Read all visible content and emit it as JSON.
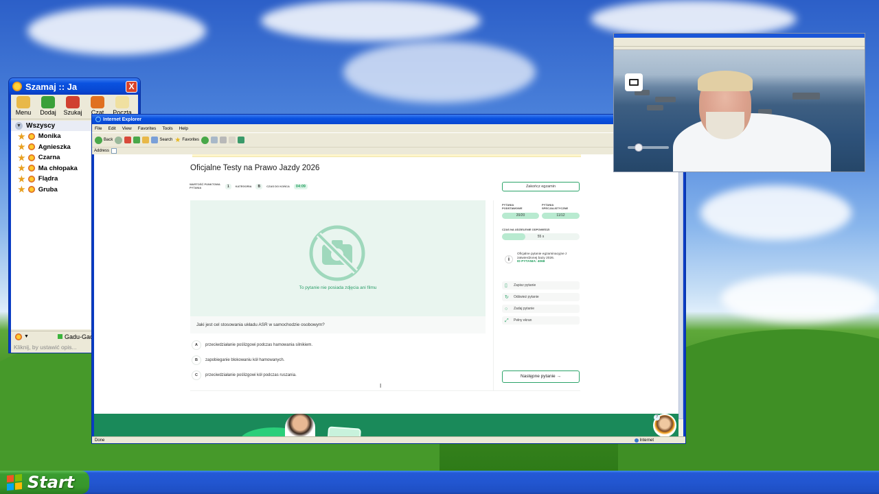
{
  "taskbar": {
    "start_label": "Start"
  },
  "gg_window": {
    "title": "Szamaj :: Ja",
    "close_label": "X",
    "toolbar": [
      "Menu",
      "Dodaj",
      "Szukaj",
      "Czat",
      "Poczta"
    ],
    "group": "Wszyscy",
    "contacts": [
      "Monika",
      "Agnieszka",
      "Czarna",
      "Ma chłopaka",
      "Flądra",
      "Gruba"
    ],
    "status_network": "Gadu-Gadu",
    "description_placeholder": "Kliknij, by ustawić opis..."
  },
  "ie_window": {
    "title": "Internet Explorer",
    "menu": [
      "File",
      "Edit",
      "View",
      "Favorites",
      "Tools",
      "Help"
    ],
    "toolbar": {
      "back": "Back",
      "search": "Search",
      "favorites": "Favorites"
    },
    "address_label": "Address",
    "status_left": "Done",
    "status_zone": "Internet"
  },
  "exam": {
    "title": "Oficjalne Testy na Prawo Jazdy 2026",
    "meta": {
      "points_label": "WARTOŚĆ PUNKTOWA PYTANIA",
      "points_value": "1",
      "category_label": "KATEGORIA",
      "category_value": "B",
      "time_label": "CZAS DO KOŃCA",
      "time_value": "04:09"
    },
    "no_media_text": "To pytanie nie posiada zdjęcia ani filmu",
    "question": "Jaki jest cel stosowania układu ASR w samochodzie osobowym?",
    "answers": [
      {
        "letter": "A",
        "text": "przeciwdziałanie poślizgowi podczas hamowania silnikiem."
      },
      {
        "letter": "B",
        "text": "zapobieganie blokowaniu kół hamowanych."
      },
      {
        "letter": "C",
        "text": "przeciwdziałanie poślizgowi kół podczas ruszania."
      }
    ],
    "end_button": "Zakończ egzamin",
    "basic_label": "PYTANIA PODSTAWOWE",
    "basic_value": "20/20",
    "special_label": "PYTANIA SPECJALISTYCZNE",
    "special_value": "11/12",
    "answer_time_label": "CZAS NA UDZIELENIE ODPOWIEDZI",
    "answer_time_value": "55 s",
    "answer_time_fraction": 0.3,
    "info_text": "Oficjalne pytanie egzaminacyjne z zatwierdzonej bazy 2026.",
    "info_id": "ID PYTANIA: 4068",
    "actions": [
      "Zapisz pytanie",
      "Odśwież pytanie",
      "Zadaj pytanie",
      "Pełny ekran"
    ],
    "next_button": "Następne pytanie →"
  },
  "colors": {
    "accent_green": "#2aa368",
    "xp_blue": "#0a52e0",
    "start_green": "#3a9c30"
  }
}
